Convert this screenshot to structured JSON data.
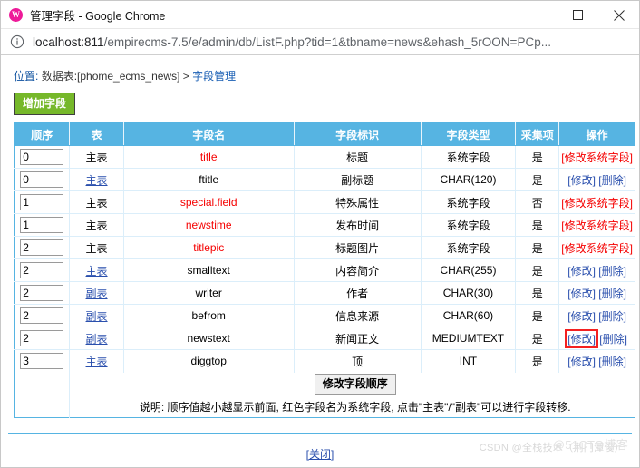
{
  "browser": {
    "title": "管理字段 - Google Chrome",
    "favicon_glyph": "W",
    "favicon_color": "#ee1a99",
    "minimize_label": "最小化",
    "maximize_label": "最大化",
    "close_label": "关闭",
    "url_host": "localhost:811",
    "url_path": "/empirecms-7.5/e/admin/db/ListF.php?tid=1&tbname=news&ehash_5rOON=PCp..."
  },
  "page": {
    "breadcrumb_label": "位置:",
    "breadcrumb_table": "数据表:[phome_ecms_news]",
    "breadcrumb_sep": ">",
    "breadcrumb_current": "字段管理",
    "add_field_button": "增加字段",
    "order_button": "修改字段顺序",
    "note": "说明: 顺序值越小越显示前面, 红色字段名为系统字段, 点击\"主表\"/\"副表\"可以进行字段转移.",
    "close_link": "[关闭]",
    "watermark_1": "CSDN @全栈技术（荆门潭俊）",
    "watermark_2": "@51CTO博客"
  },
  "theme": {
    "header_blue": "#56b4e2",
    "link_blue": "#2a4fad",
    "system_red": "#f50000",
    "button_green": "#76b82a",
    "highlight_red": "#f42020"
  },
  "table": {
    "columns": [
      "顺序",
      "表",
      "字段名",
      "字段标识",
      "字段类型",
      "采集项",
      "操作"
    ],
    "ops_system_label": "[修改系统字段]",
    "ops_edit_label": "[修改]",
    "ops_delete_label": "[删除]",
    "rows": [
      {
        "order": "0",
        "table": "主表",
        "table_is_link": false,
        "name": "title",
        "name_is_system": true,
        "label": "标题",
        "type": "系统字段",
        "collect": "是",
        "ops": "system",
        "highlight": false
      },
      {
        "order": "0",
        "table": "主表",
        "table_is_link": true,
        "name": "ftitle",
        "name_is_system": false,
        "label": "副标题",
        "type": "CHAR(120)",
        "collect": "是",
        "ops": "editdel",
        "highlight": false
      },
      {
        "order": "1",
        "table": "主表",
        "table_is_link": false,
        "name": "special.field",
        "name_is_system": true,
        "label": "特殊属性",
        "type": "系统字段",
        "collect": "否",
        "ops": "system",
        "highlight": false
      },
      {
        "order": "1",
        "table": "主表",
        "table_is_link": false,
        "name": "newstime",
        "name_is_system": true,
        "label": "发布时间",
        "type": "系统字段",
        "collect": "是",
        "ops": "system",
        "highlight": false
      },
      {
        "order": "2",
        "table": "主表",
        "table_is_link": false,
        "name": "titlepic",
        "name_is_system": true,
        "label": "标题图片",
        "type": "系统字段",
        "collect": "是",
        "ops": "system",
        "highlight": false
      },
      {
        "order": "2",
        "table": "主表",
        "table_is_link": true,
        "name": "smalltext",
        "name_is_system": false,
        "label": "内容简介",
        "type": "CHAR(255)",
        "collect": "是",
        "ops": "editdel",
        "highlight": false
      },
      {
        "order": "2",
        "table": "副表",
        "table_is_link": true,
        "name": "writer",
        "name_is_system": false,
        "label": "作者",
        "type": "CHAR(30)",
        "collect": "是",
        "ops": "editdel",
        "highlight": false
      },
      {
        "order": "2",
        "table": "副表",
        "table_is_link": true,
        "name": "befrom",
        "name_is_system": false,
        "label": "信息来源",
        "type": "CHAR(60)",
        "collect": "是",
        "ops": "editdel",
        "highlight": false
      },
      {
        "order": "2",
        "table": "副表",
        "table_is_link": true,
        "name": "newstext",
        "name_is_system": false,
        "label": "新闻正文",
        "type": "MEDIUMTEXT",
        "collect": "是",
        "ops": "editdel",
        "highlight": true
      },
      {
        "order": "3",
        "table": "主表",
        "table_is_link": true,
        "name": "diggtop",
        "name_is_system": false,
        "label": "顶",
        "type": "INT",
        "collect": "是",
        "ops": "editdel",
        "highlight": false
      }
    ]
  }
}
